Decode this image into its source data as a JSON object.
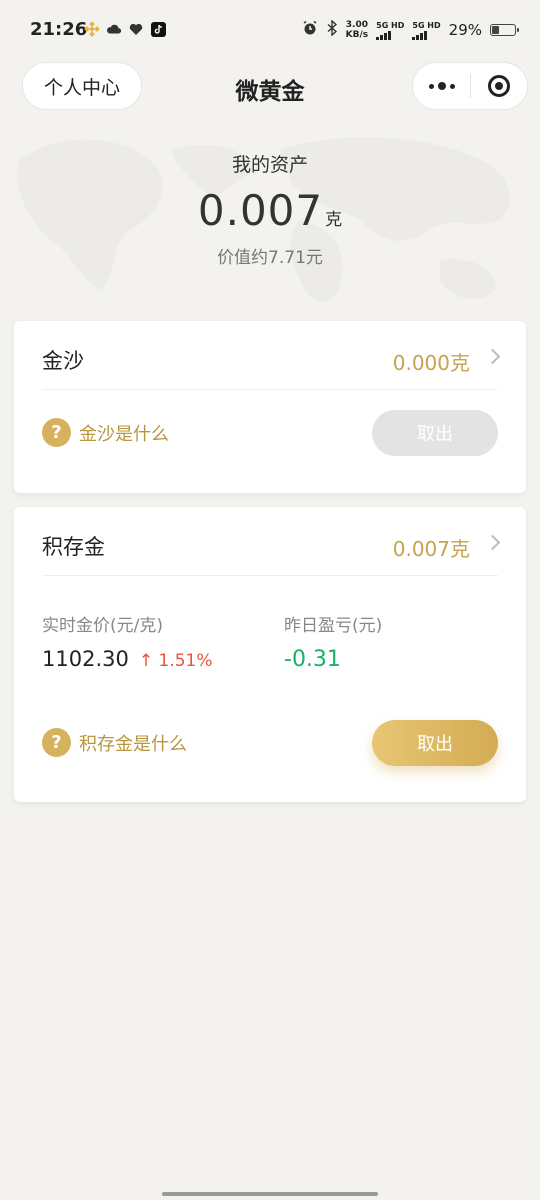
{
  "status_bar": {
    "time": "21:26",
    "net_speed_value": "3.00",
    "net_speed_unit": "KB/s",
    "net1": "5G HD",
    "net2": "5G HD",
    "battery": "29%"
  },
  "nav": {
    "left_button": "个人中心",
    "title": "微黄金"
  },
  "asset": {
    "label": "我的资产",
    "amount": "0.007",
    "unit": "克",
    "value_text": "价值约7.71元"
  },
  "card_sand": {
    "title": "金沙",
    "amount": "0.000克",
    "help": "金沙是什么",
    "button": "取出"
  },
  "card_store": {
    "title": "积存金",
    "amount": "0.007克",
    "price_label": "实时金价(元/克)",
    "price_value": "1102.30",
    "price_change": "↑ 1.51%",
    "pnl_label": "昨日盈亏(元)",
    "pnl_value": "-0.31",
    "help": "积存金是什么",
    "button": "取出"
  },
  "colors": {
    "gold_text": "#c7a24f",
    "gold_button": "#d4ab53",
    "up": "#e8533b",
    "down": "#19b06a"
  }
}
